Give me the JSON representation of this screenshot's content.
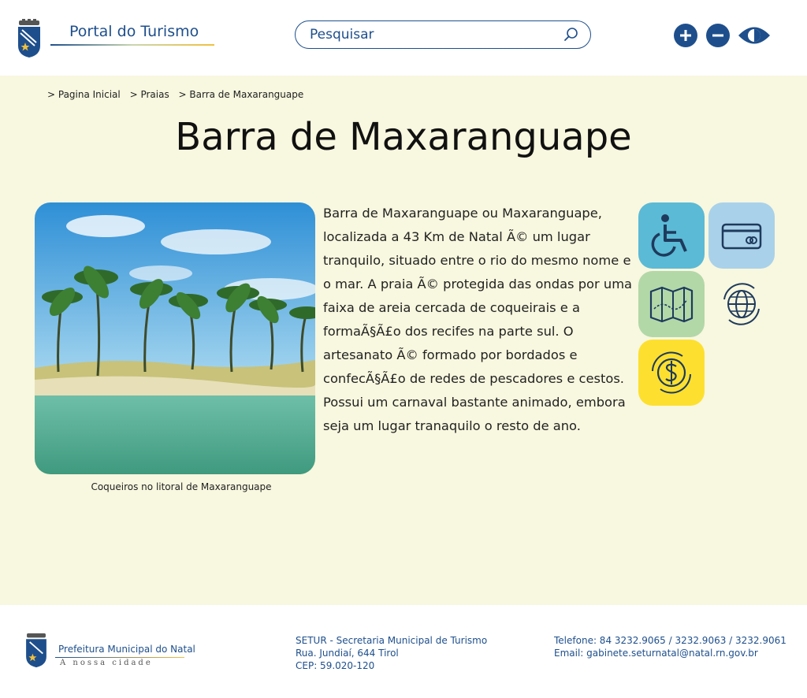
{
  "header": {
    "site_title": "Portal do Turismo",
    "search_placeholder": "Pesquisar",
    "accessibility": {
      "increase_icon": "plus-icon",
      "decrease_icon": "minus-icon",
      "contrast_icon": "eye-icon"
    },
    "brand_color": "#1e4f8c"
  },
  "breadcrumb": [
    "> Pagina Inicial",
    "> Praias",
    "> Barra de Maxaranguape"
  ],
  "page": {
    "title": "Barra de Maxaranguape",
    "background": "#f8f7df",
    "image_caption": "Coqueiros no litoral de Maxaranguape",
    "description": "Barra de Maxaranguape ou Maxaranguape, localizada a 43 Km de Natal Ã© um lugar tranquilo, situado entre o rio do mesmo nome e o mar. A praia Ã© protegida das ondas por uma faixa de areia cercada de coqueirais e a formaÃ§Ã£o dos recifes na parte sul. O artesanato Ã© formado por bordados e confecÃ§Ã£o de redes de pescadores e cestos. Possui um carnaval bastante animado, embora seja um lugar tranaquilo o resto de ano."
  },
  "info_icons": [
    {
      "icon": "wheelchair-icon",
      "color": "#5bbad5"
    },
    {
      "icon": "credit-card-icon",
      "color": "#a9d1ea"
    },
    {
      "icon": "map-icon",
      "color": "#b2d8a8"
    },
    {
      "icon": "globe-icon",
      "color": "#f8f7df"
    },
    {
      "icon": "money-icon",
      "color": "#fde02f"
    }
  ],
  "footer": {
    "logo_title": "Prefeitura Municipal do Natal",
    "logo_subtitle": "A nossa cidade",
    "address": [
      "SETUR - Secretaria Municipal de Turismo",
      "Rua. Jundiaí, 644 Tirol",
      "CEP: 59.020-120"
    ],
    "contact": [
      "Telefone: 84 3232.9065 / 3232.9063 / 3232.9061",
      "Email: gabinete.seturnatal@natal.rn.gov.br"
    ]
  }
}
